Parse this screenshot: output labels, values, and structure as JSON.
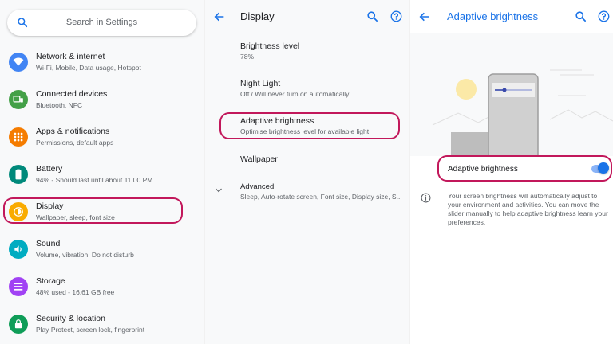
{
  "settings": {
    "search_placeholder": "Search in Settings",
    "items": [
      {
        "title": "Network & internet",
        "subtitle": "Wi-Fi, Mobile, Data usage, Hotspot",
        "icon": "wifi-icon",
        "color": "#4285f4"
      },
      {
        "title": "Connected devices",
        "subtitle": "Bluetooth, NFC",
        "icon": "devices-icon",
        "color": "#43a047"
      },
      {
        "title": "Apps & notifications",
        "subtitle": "Permissions, default apps",
        "icon": "apps-icon",
        "color": "#f57c00"
      },
      {
        "title": "Battery",
        "subtitle": "94% - Should last until about 11:00 PM",
        "icon": "battery-icon",
        "color": "#00897b"
      },
      {
        "title": "Display",
        "subtitle": "Wallpaper, sleep, font size",
        "icon": "brightness-icon",
        "color": "#f9ab00"
      },
      {
        "title": "Sound",
        "subtitle": "Volume, vibration, Do not disturb",
        "icon": "volume-icon",
        "color": "#00acc1"
      },
      {
        "title": "Storage",
        "subtitle": "48% used - 16.61 GB free",
        "icon": "storage-icon",
        "color": "#a142f4"
      },
      {
        "title": "Security & location",
        "subtitle": "Play Protect, screen lock, fingerprint",
        "icon": "lock-icon",
        "color": "#0f9d58"
      }
    ]
  },
  "display": {
    "title": "Display",
    "items": [
      {
        "title": "Brightness level",
        "subtitle": "78%"
      },
      {
        "title": "Night Light",
        "subtitle": "Off / Will never turn on automatically"
      },
      {
        "title": "Adaptive brightness",
        "subtitle": "Optimise brightness level for available light"
      },
      {
        "title": "Wallpaper",
        "subtitle": ""
      },
      {
        "title": "Advanced",
        "subtitle": "Sleep, Auto-rotate screen, Font size, Display size, S..."
      }
    ]
  },
  "adaptive": {
    "title": "Adaptive brightness",
    "toggle_label": "Adaptive brightness",
    "toggle_on": true,
    "info_text": "Your screen brightness will automatically adjust to your environment and activities. You can move the slider manually to help adaptive brightness learn your preferences."
  },
  "colors": {
    "accent": "#1a73e8",
    "highlight": "#c2185b"
  }
}
